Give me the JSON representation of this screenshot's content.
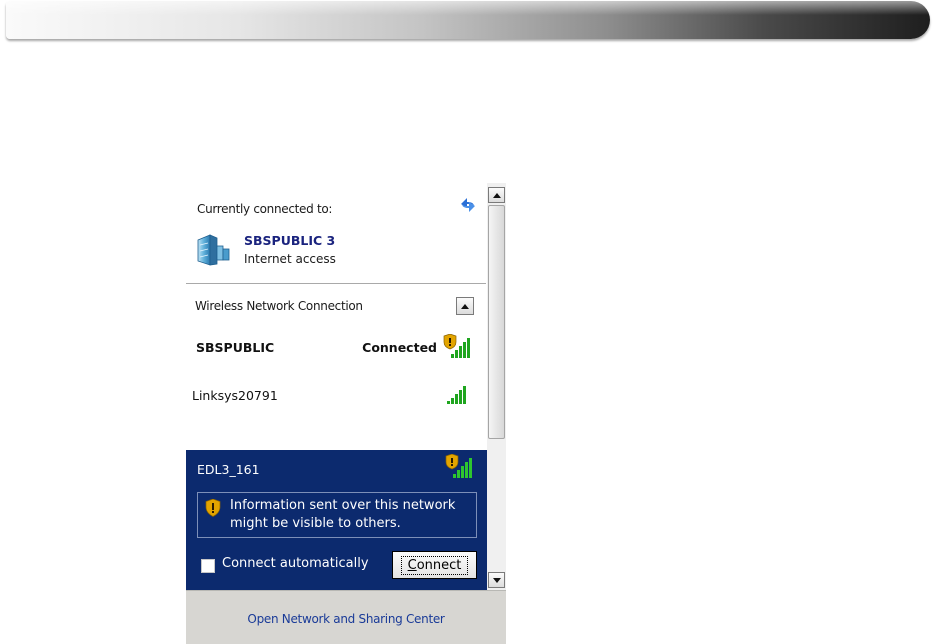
{
  "flyout": {
    "header": {
      "title": "Currently connected to:",
      "refresh_icon": "refresh-icon"
    },
    "current_connection": {
      "name": "SBSPUBLIC 3",
      "status": "Internet access",
      "icon": "network-icon"
    },
    "section": {
      "title": "Wireless Network Connection",
      "toggle_icon": "chevron-up-icon"
    },
    "networks": [
      {
        "name": "SBSPUBLIC",
        "status": "Connected",
        "secured": false,
        "shield": true
      },
      {
        "name": "Linksys20791",
        "status": "",
        "secured": true,
        "shield": false
      }
    ],
    "selected": {
      "name": "EDL3_161",
      "warning": "Information sent over this network might be visible to others.",
      "warning_line1": "Information sent over this network",
      "warning_line2": "might be visible to others.",
      "auto_connect_label": "Connect automatically",
      "auto_connect_checked": false,
      "connect_label_prefix": "",
      "connect_label_accel": "C",
      "connect_label_rest": "onnect"
    },
    "footer": {
      "link": "Open Network and Sharing Center"
    }
  },
  "colors": {
    "selected_bg": "#0c2a6e",
    "link": "#1a3b98",
    "connection_name": "#1a237e",
    "signal_green": "#1fa51f",
    "shield_gold": "#e2a400",
    "footer_bg": "#d7d6d2"
  }
}
